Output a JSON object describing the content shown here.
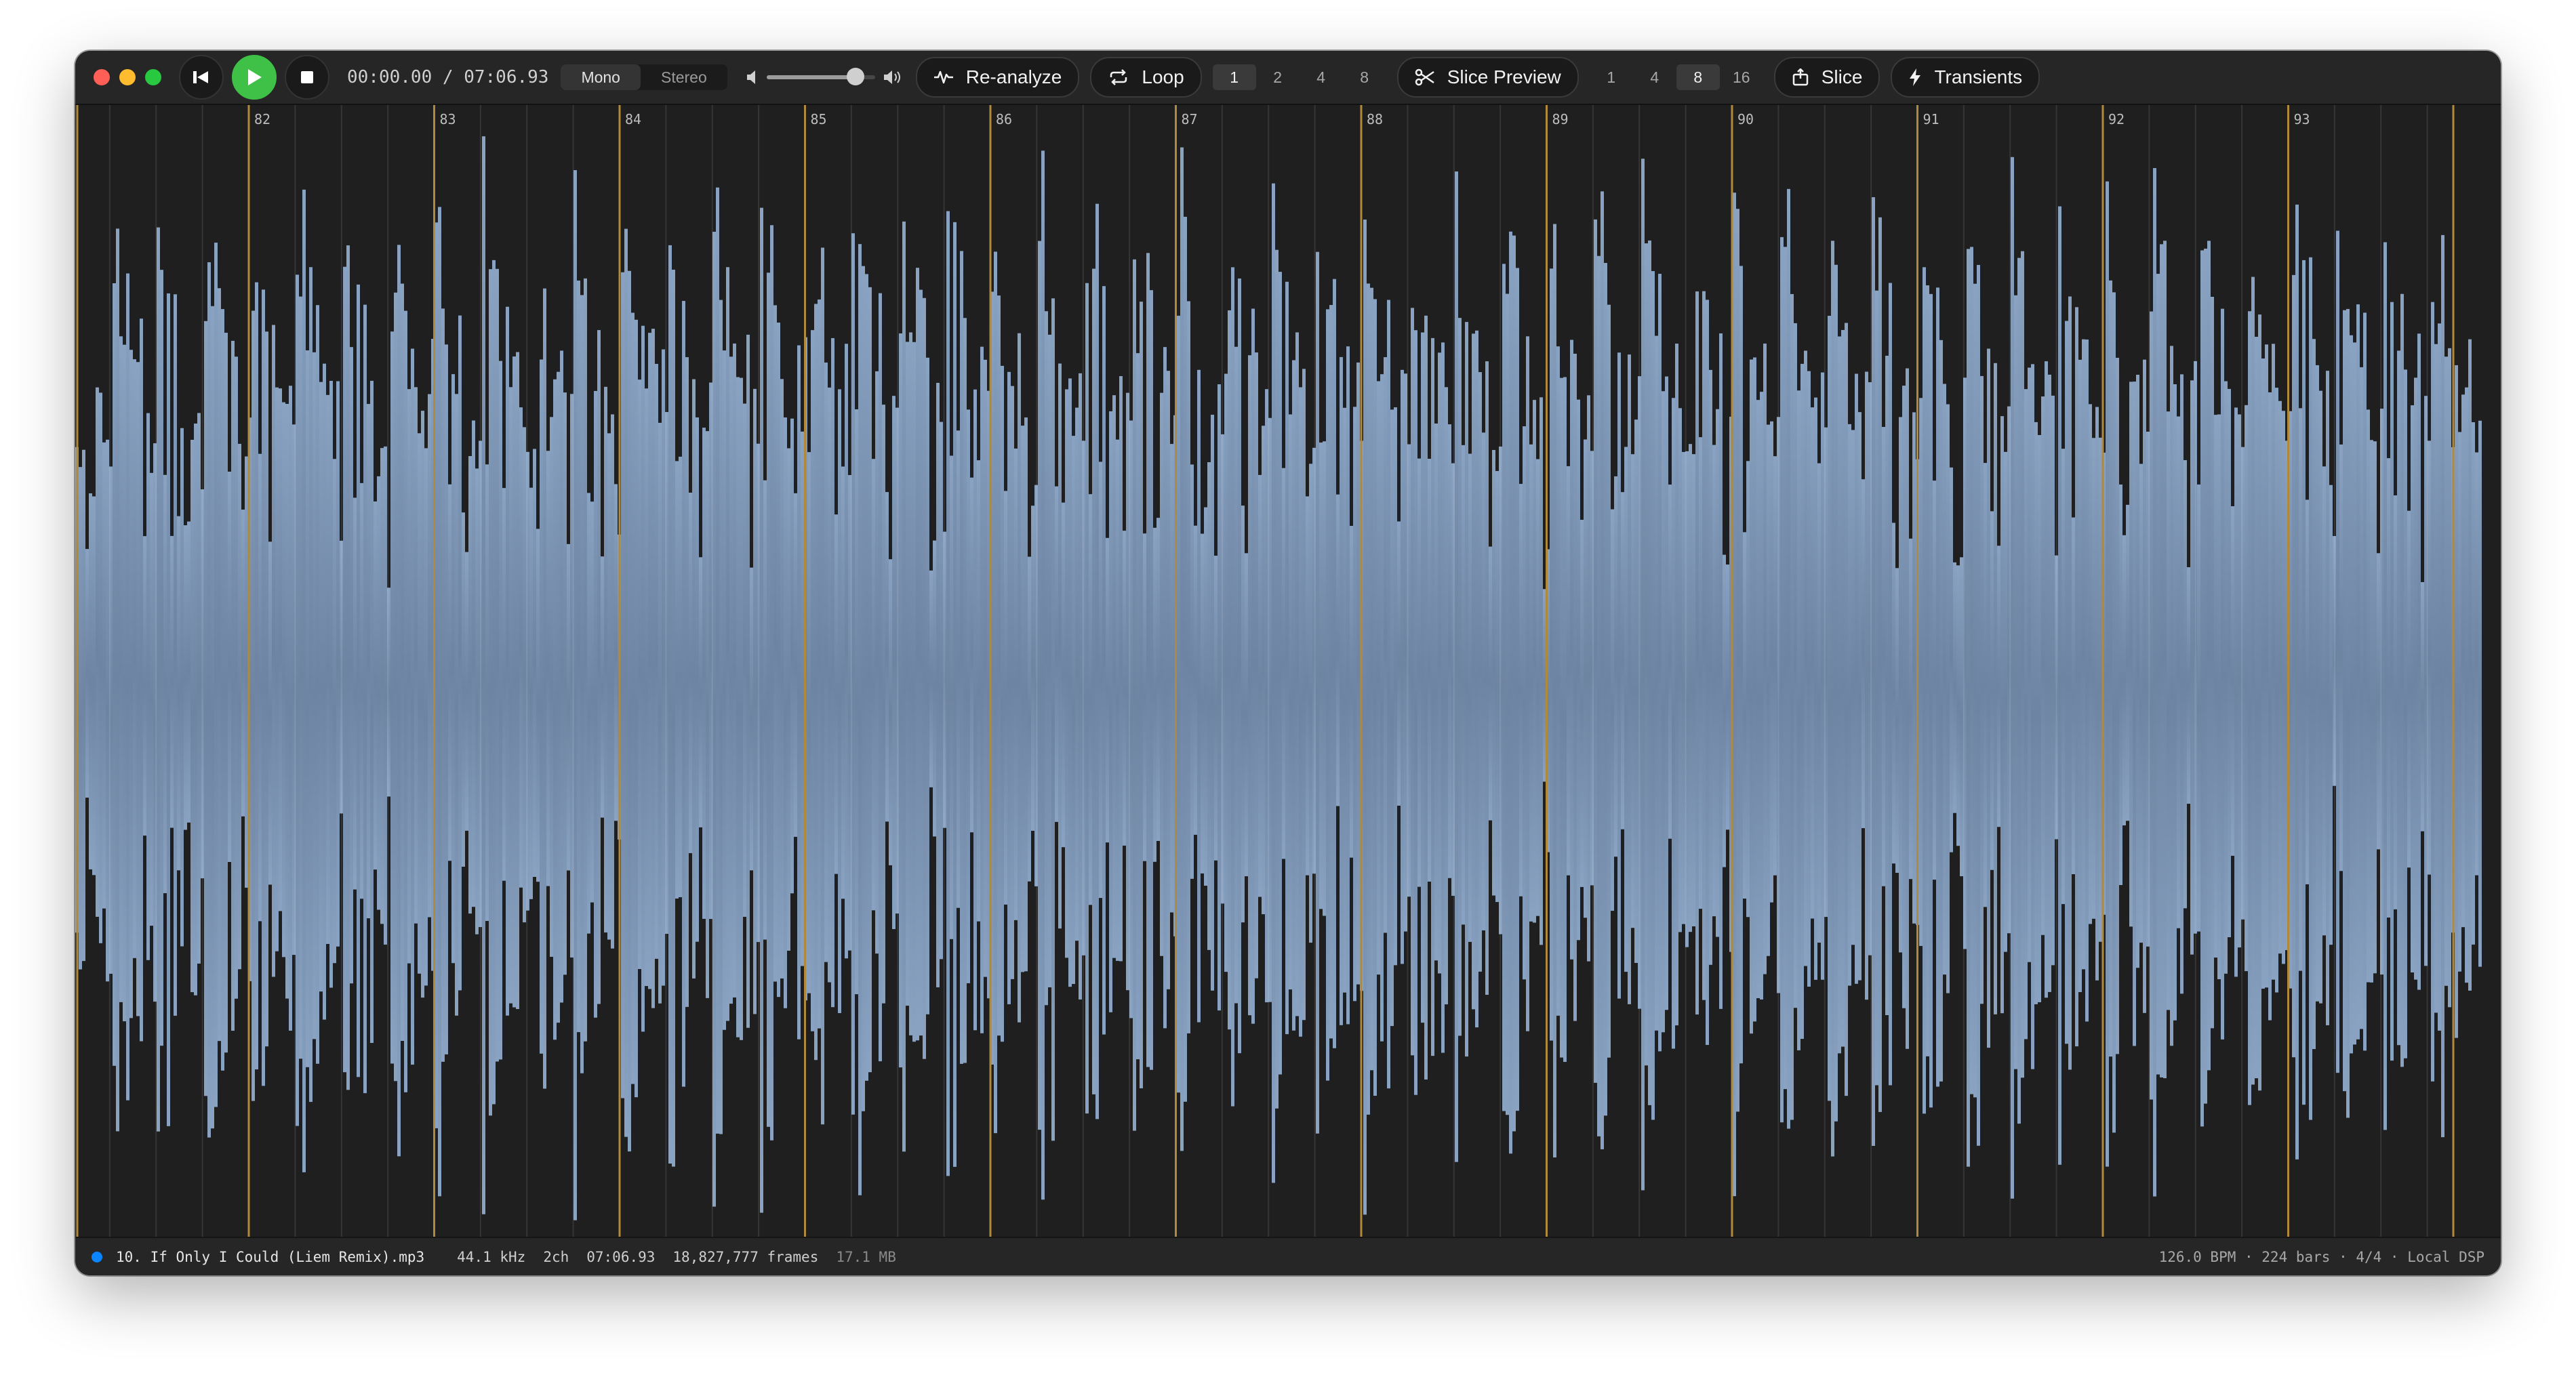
{
  "transport": {
    "time_current": "00:00.00",
    "time_separator": "/",
    "time_total": "07:06.93"
  },
  "channel_mode": {
    "options": [
      "Mono",
      "Stereo"
    ],
    "selected": "Mono"
  },
  "volume": {
    "level": 0.82
  },
  "buttons": {
    "reanalyze": "Re-analyze",
    "loop": "Loop",
    "slice_preview": "Slice Preview",
    "slice": "Slice",
    "transients": "Transients"
  },
  "loop_bars": {
    "options": [
      "1",
      "2",
      "4",
      "8"
    ],
    "selected": "1"
  },
  "slice_div": {
    "options": [
      "1",
      "4",
      "8",
      "16"
    ],
    "selected": "8"
  },
  "waveform": {
    "bar_markers": [
      "82",
      "83",
      "84",
      "85",
      "86",
      "87",
      "88",
      "89",
      "90",
      "91",
      "92",
      "93"
    ],
    "first_bar": 82,
    "color": "#7d94b1",
    "marker_color": "#b08a3a"
  },
  "status": {
    "file_name": "10. If Only I Could (Liem Remix).mp3",
    "sample_rate": "44.1 kHz",
    "channels": "2ch",
    "duration": "07:06.93",
    "frames": "18,827,777 frames",
    "size": "17.1 MB",
    "right": "126.0 BPM · 224 bars · 4/4 · Local DSP"
  }
}
